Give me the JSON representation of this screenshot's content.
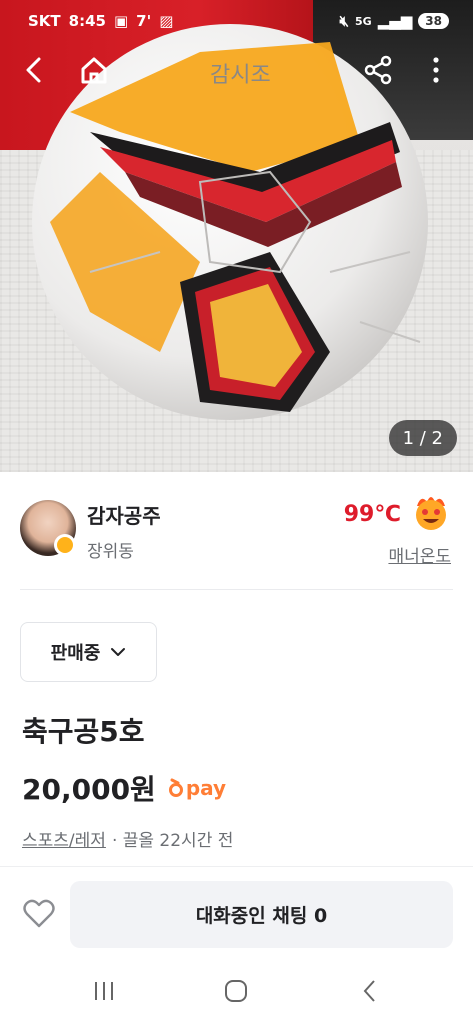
{
  "status_bar": {
    "carrier": "SKT",
    "time": "8:45",
    "extra": "7'",
    "network": "5G",
    "battery": "38"
  },
  "top_nav": {
    "back_icon": "chevron-left-icon",
    "home_icon": "home-icon",
    "share_icon": "share-icon",
    "more_icon": "more-vertical-icon"
  },
  "photo": {
    "counter": "1 / 2"
  },
  "seller": {
    "name": "감자공주",
    "location": "장위동",
    "temperature": "99℃",
    "manner_label": "매너온도"
  },
  "product": {
    "status": "판매중",
    "title": "축구공5호",
    "price": "20,000원",
    "pay_label": "pay",
    "category": "스포츠/레저",
    "bump_time": "· 끌올 22시간 전"
  },
  "bottom": {
    "chat_button": "대화중인 채팅 0"
  },
  "colors": {
    "accent": "#ff7e36",
    "temperature": "#de1c2b",
    "text": "#212124",
    "subtext": "#6b6e73"
  }
}
